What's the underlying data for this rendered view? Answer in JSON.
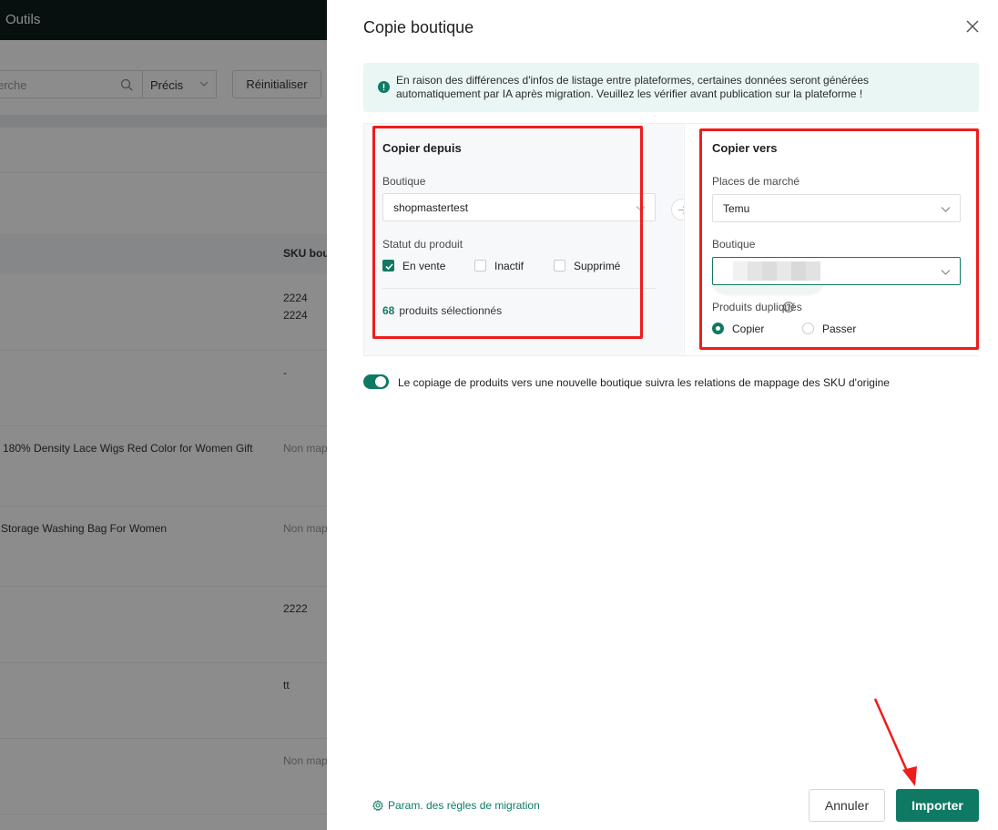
{
  "background": {
    "nav_label": "Outils",
    "search_placeholder": "erche",
    "match_select": "Précis",
    "reset_button": "Réinitialiser",
    "column_header": "SKU bou",
    "rows": [
      {
        "name": "",
        "sku": "2224\n2224"
      },
      {
        "name": "",
        "sku": "-"
      },
      {
        "name": "180% Density Lace Wigs Red Color for Women Gift",
        "sku": "Non map"
      },
      {
        "name": "Storage Washing Bag For Women",
        "sku": "Non map"
      },
      {
        "name": "",
        "sku": "2222"
      },
      {
        "name": "",
        "sku": "tt"
      },
      {
        "name": "",
        "sku": "Non map"
      }
    ]
  },
  "drawer": {
    "title": "Copie boutique",
    "notice": "En raison des différences d'infos de listage entre plateformes, certaines données seront générées automatiquement par IA après migration. Veuillez les vérifier avant publication sur la plateforme !",
    "source": {
      "title": "Copier depuis",
      "shop_label": "Boutique",
      "shop_value": "shopmastertest",
      "status_label": "Statut du produit",
      "statuses": [
        {
          "label": "En vente",
          "checked": true
        },
        {
          "label": "Inactif",
          "checked": false
        },
        {
          "label": "Supprimé",
          "checked": false
        }
      ],
      "selected_count": "68",
      "selected_suffix": "produits sélectionnés"
    },
    "target": {
      "title": "Copier vers",
      "marketplace_label": "Places de marché",
      "marketplace_value": "Temu",
      "shop_label": "Boutique",
      "shop_value": "",
      "duplicates_label": "Produits dupliqués",
      "duplicate_options": [
        {
          "label": "Copier",
          "selected": true
        },
        {
          "label": "Passer",
          "selected": false
        }
      ]
    },
    "toggle_on": true,
    "toggle_text": "Le copiage de produits vers une nouvelle boutique suivra les relations de mappage des SKU d'origine",
    "migration_rules_link": "Param. des règles de migration",
    "cancel_button": "Annuler",
    "import_button": "Importer"
  },
  "colors": {
    "accent": "#0f7a63",
    "annotation": "#ef1c1c",
    "notice_bg": "#eaf6f3"
  }
}
